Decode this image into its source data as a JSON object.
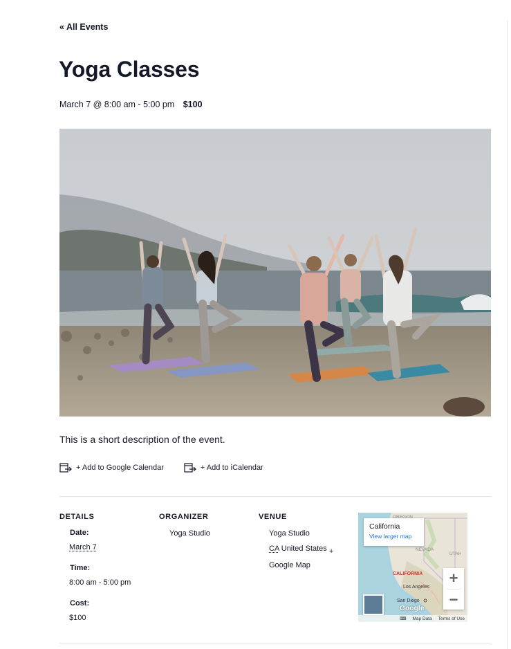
{
  "nav": {
    "back_label": "« All Events"
  },
  "event": {
    "title": "Yoga Classes",
    "schedule": "March 7 @ 8:00 am - 5:00 pm",
    "cost": "$100",
    "description": "This is a short description of the event."
  },
  "calendar_links": [
    {
      "label": "+ Add to Google Calendar",
      "icon": "calendar-export-icon"
    },
    {
      "label": "+ Add to iCalendar",
      "icon": "calendar-export-icon"
    }
  ],
  "details": {
    "heading": "DETAILS",
    "date_label": "Date:",
    "date_value": "March 7",
    "time_label": "Time:",
    "time_value": "8:00 am - 5:00 pm",
    "cost_label": "Cost:",
    "cost_value": "$100"
  },
  "organizer": {
    "heading": "ORGANIZER",
    "name": "Yoga Studio"
  },
  "venue": {
    "heading": "VENUE",
    "name": "Yoga Studio",
    "region_abbr": "CA",
    "country": "United States",
    "map_link": "+ Google Map"
  },
  "map": {
    "place": "California",
    "larger_map_label": "View larger map",
    "zoom_in": "+",
    "zoom_out": "−",
    "map_data_label": "Map Data",
    "terms_label": "Terms of Use",
    "brand_label": "Google",
    "labels": [
      "OREGON",
      "NEVADA",
      "UTAH",
      "CALIFORNIA",
      "Los Angeles",
      "San Diego"
    ]
  },
  "colors": {
    "text": "#141827",
    "rule": "#e4e4e4",
    "link_blue": "#1a73e8"
  }
}
